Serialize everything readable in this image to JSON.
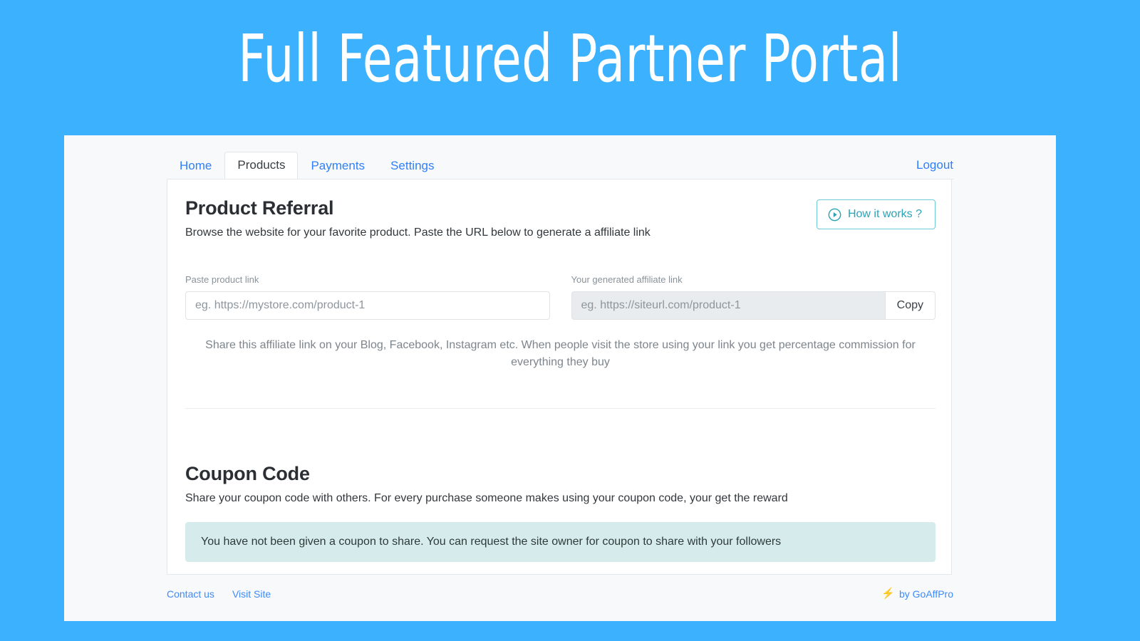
{
  "hero": {
    "title": "Full Featured Partner Portal",
    "background_color": "#3cb1fd"
  },
  "nav": {
    "tabs": [
      {
        "label": "Home",
        "active": false
      },
      {
        "label": "Products",
        "active": true
      },
      {
        "label": "Payments",
        "active": false
      },
      {
        "label": "Settings",
        "active": false
      }
    ],
    "logout_label": "Logout"
  },
  "referral": {
    "title": "Product Referral",
    "description": "Browse the website for your favorite product. Paste the URL below to generate a affiliate link",
    "how_it_works_label": "How it works ?",
    "how_it_works_icon": "play-circle-icon",
    "accent_color": "#2ba3b5",
    "product_link_label": "Paste product link",
    "product_link_value": "",
    "product_link_placeholder": "eg. https://mystore.com/product-1",
    "affiliate_link_label": "Your generated affiliate link",
    "affiliate_link_value": "",
    "affiliate_link_placeholder": "eg. https://siteurl.com/product-1",
    "copy_label": "Copy",
    "share_note": "Share this affiliate link on your Blog, Facebook, Instagram etc. When people visit the store using your link you get percentage commission for everything they buy"
  },
  "coupon": {
    "title": "Coupon Code",
    "description": "Share your coupon code with others. For every purchase someone makes using your coupon code, your get the reward",
    "alert_text": "You have not been given a coupon to share. You can request the site owner for coupon to share with your followers",
    "alert_color": "#d6ecec"
  },
  "footer": {
    "links": [
      {
        "label": "Contact us"
      },
      {
        "label": "Visit Site"
      }
    ],
    "brand_icon": "lightning-bolt-icon",
    "brand_text": "by GoAffPro"
  }
}
